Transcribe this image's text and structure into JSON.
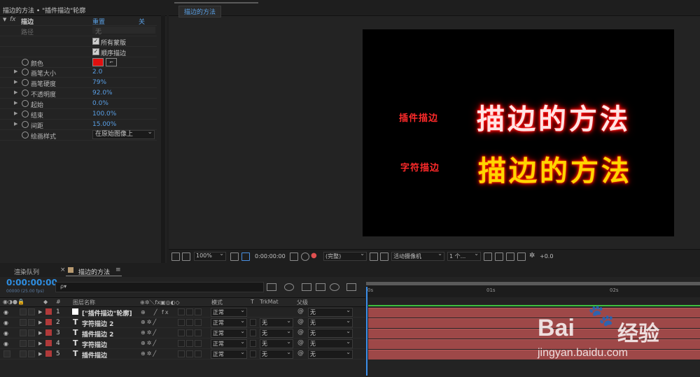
{
  "effect_controls": {
    "header": "描边的方法 • \"插件描边\"轮廓",
    "effect_name": "描边",
    "reset": "重置",
    "about": "关于...",
    "path_label": "路径",
    "path_value": "无",
    "all_masks": "所有蒙版",
    "stroke_sequentially": "顺序描边",
    "properties": [
      {
        "label": "颜色",
        "value": ""
      },
      {
        "label": "画笔大小",
        "value": "2.0"
      },
      {
        "label": "画笔硬度",
        "value": "79%"
      },
      {
        "label": "不透明度",
        "value": "92.0%"
      },
      {
        "label": "起始",
        "value": "0.0%"
      },
      {
        "label": "结束",
        "value": "100.0%"
      },
      {
        "label": "间距",
        "value": "15.00%"
      },
      {
        "label": "绘画样式",
        "value": "在原始图像上"
      }
    ],
    "color_swatch": "#e01010"
  },
  "viewer": {
    "tab": "描边的方法",
    "canvas_text": {
      "line1_small": "插件描边",
      "line1_big": "描边的方法",
      "line2_small": "字符描边",
      "line2_big": "描边的方法"
    },
    "toolbar": {
      "zoom": "100%",
      "timecode": "0:00:00:00",
      "resolution": "(完整)",
      "camera": "活动摄像机",
      "views": "1 个...",
      "exposure": "+0.0"
    }
  },
  "timeline": {
    "tabs": [
      "渲染队列",
      "描边的方法"
    ],
    "timecode": "0:00:00:00",
    "fps": "00000 (25.00 fps)",
    "search_placeholder": "ρ▾",
    "headers": {
      "num": "#",
      "layer_name": "图层名称",
      "mode": "模式",
      "t": "T",
      "trkmat": "TrkMat",
      "parent": "父级"
    },
    "layers": [
      {
        "num": "1",
        "type": "□",
        "name": "[\"插件描边\"轮廓]",
        "mode": "正常",
        "trkmat": "",
        "parent": "无"
      },
      {
        "num": "2",
        "type": "T",
        "name": "字符描边 2",
        "mode": "正常",
        "trkmat": "无",
        "parent": "无"
      },
      {
        "num": "3",
        "type": "T",
        "name": "插件描边 2",
        "mode": "正常",
        "trkmat": "无",
        "parent": "无"
      },
      {
        "num": "4",
        "type": "T",
        "name": "字符描边",
        "mode": "正常",
        "trkmat": "无",
        "parent": "无"
      },
      {
        "num": "5",
        "type": "T",
        "name": "插件描边",
        "mode": "正常",
        "trkmat": "无",
        "parent": "无"
      }
    ],
    "ruler": [
      "0s",
      "01s",
      "02s"
    ]
  },
  "watermark": {
    "brand_a": "Bai",
    "brand_b": "经验",
    "url": "jingyan.baidu.com"
  }
}
